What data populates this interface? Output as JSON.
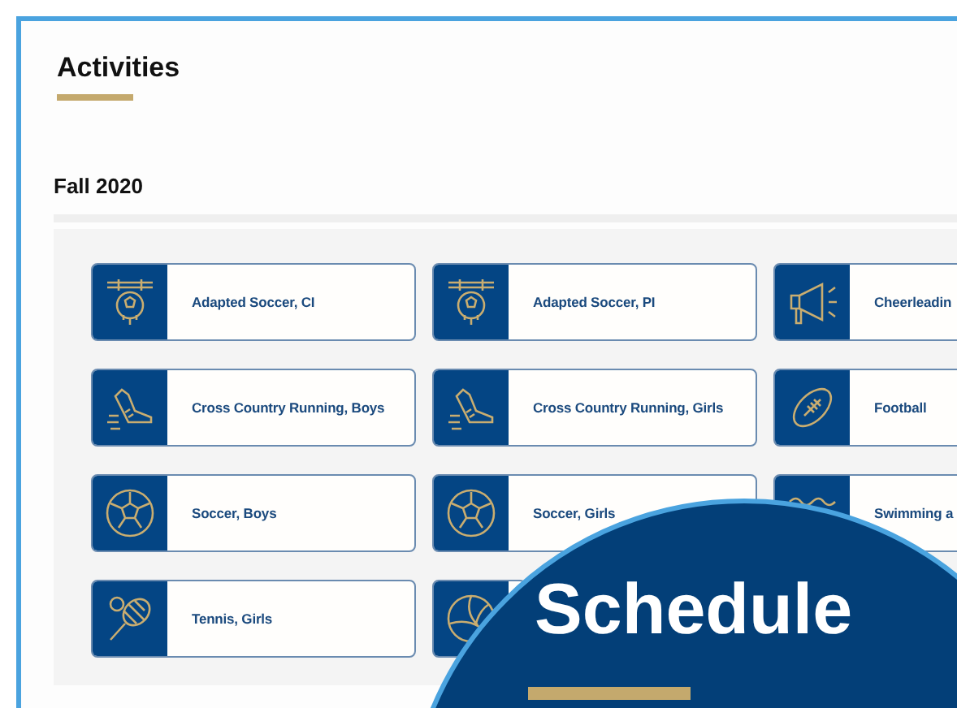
{
  "page": {
    "title": "Activities"
  },
  "season": {
    "title": "Fall 2020"
  },
  "activities": [
    {
      "kind": "goal",
      "label": "Adapted Soccer, CI"
    },
    {
      "kind": "goal",
      "label": "Adapted Soccer, PI"
    },
    {
      "kind": "megaphone",
      "label": "Cheerleadin"
    },
    {
      "kind": "shoe",
      "label": "Cross Country Running, Boys"
    },
    {
      "kind": "shoe",
      "label": "Cross Country Running, Girls"
    },
    {
      "kind": "football",
      "label": "Football"
    },
    {
      "kind": "ball",
      "label": "Soccer, Boys"
    },
    {
      "kind": "ball",
      "label": "Soccer, Girls"
    },
    {
      "kind": "waves",
      "label": "Swimming a"
    },
    {
      "kind": "tennis",
      "label": "Tennis, Girls"
    },
    {
      "kind": "volleyball"
    }
  ],
  "overlay": {
    "title": "Schedule"
  }
}
